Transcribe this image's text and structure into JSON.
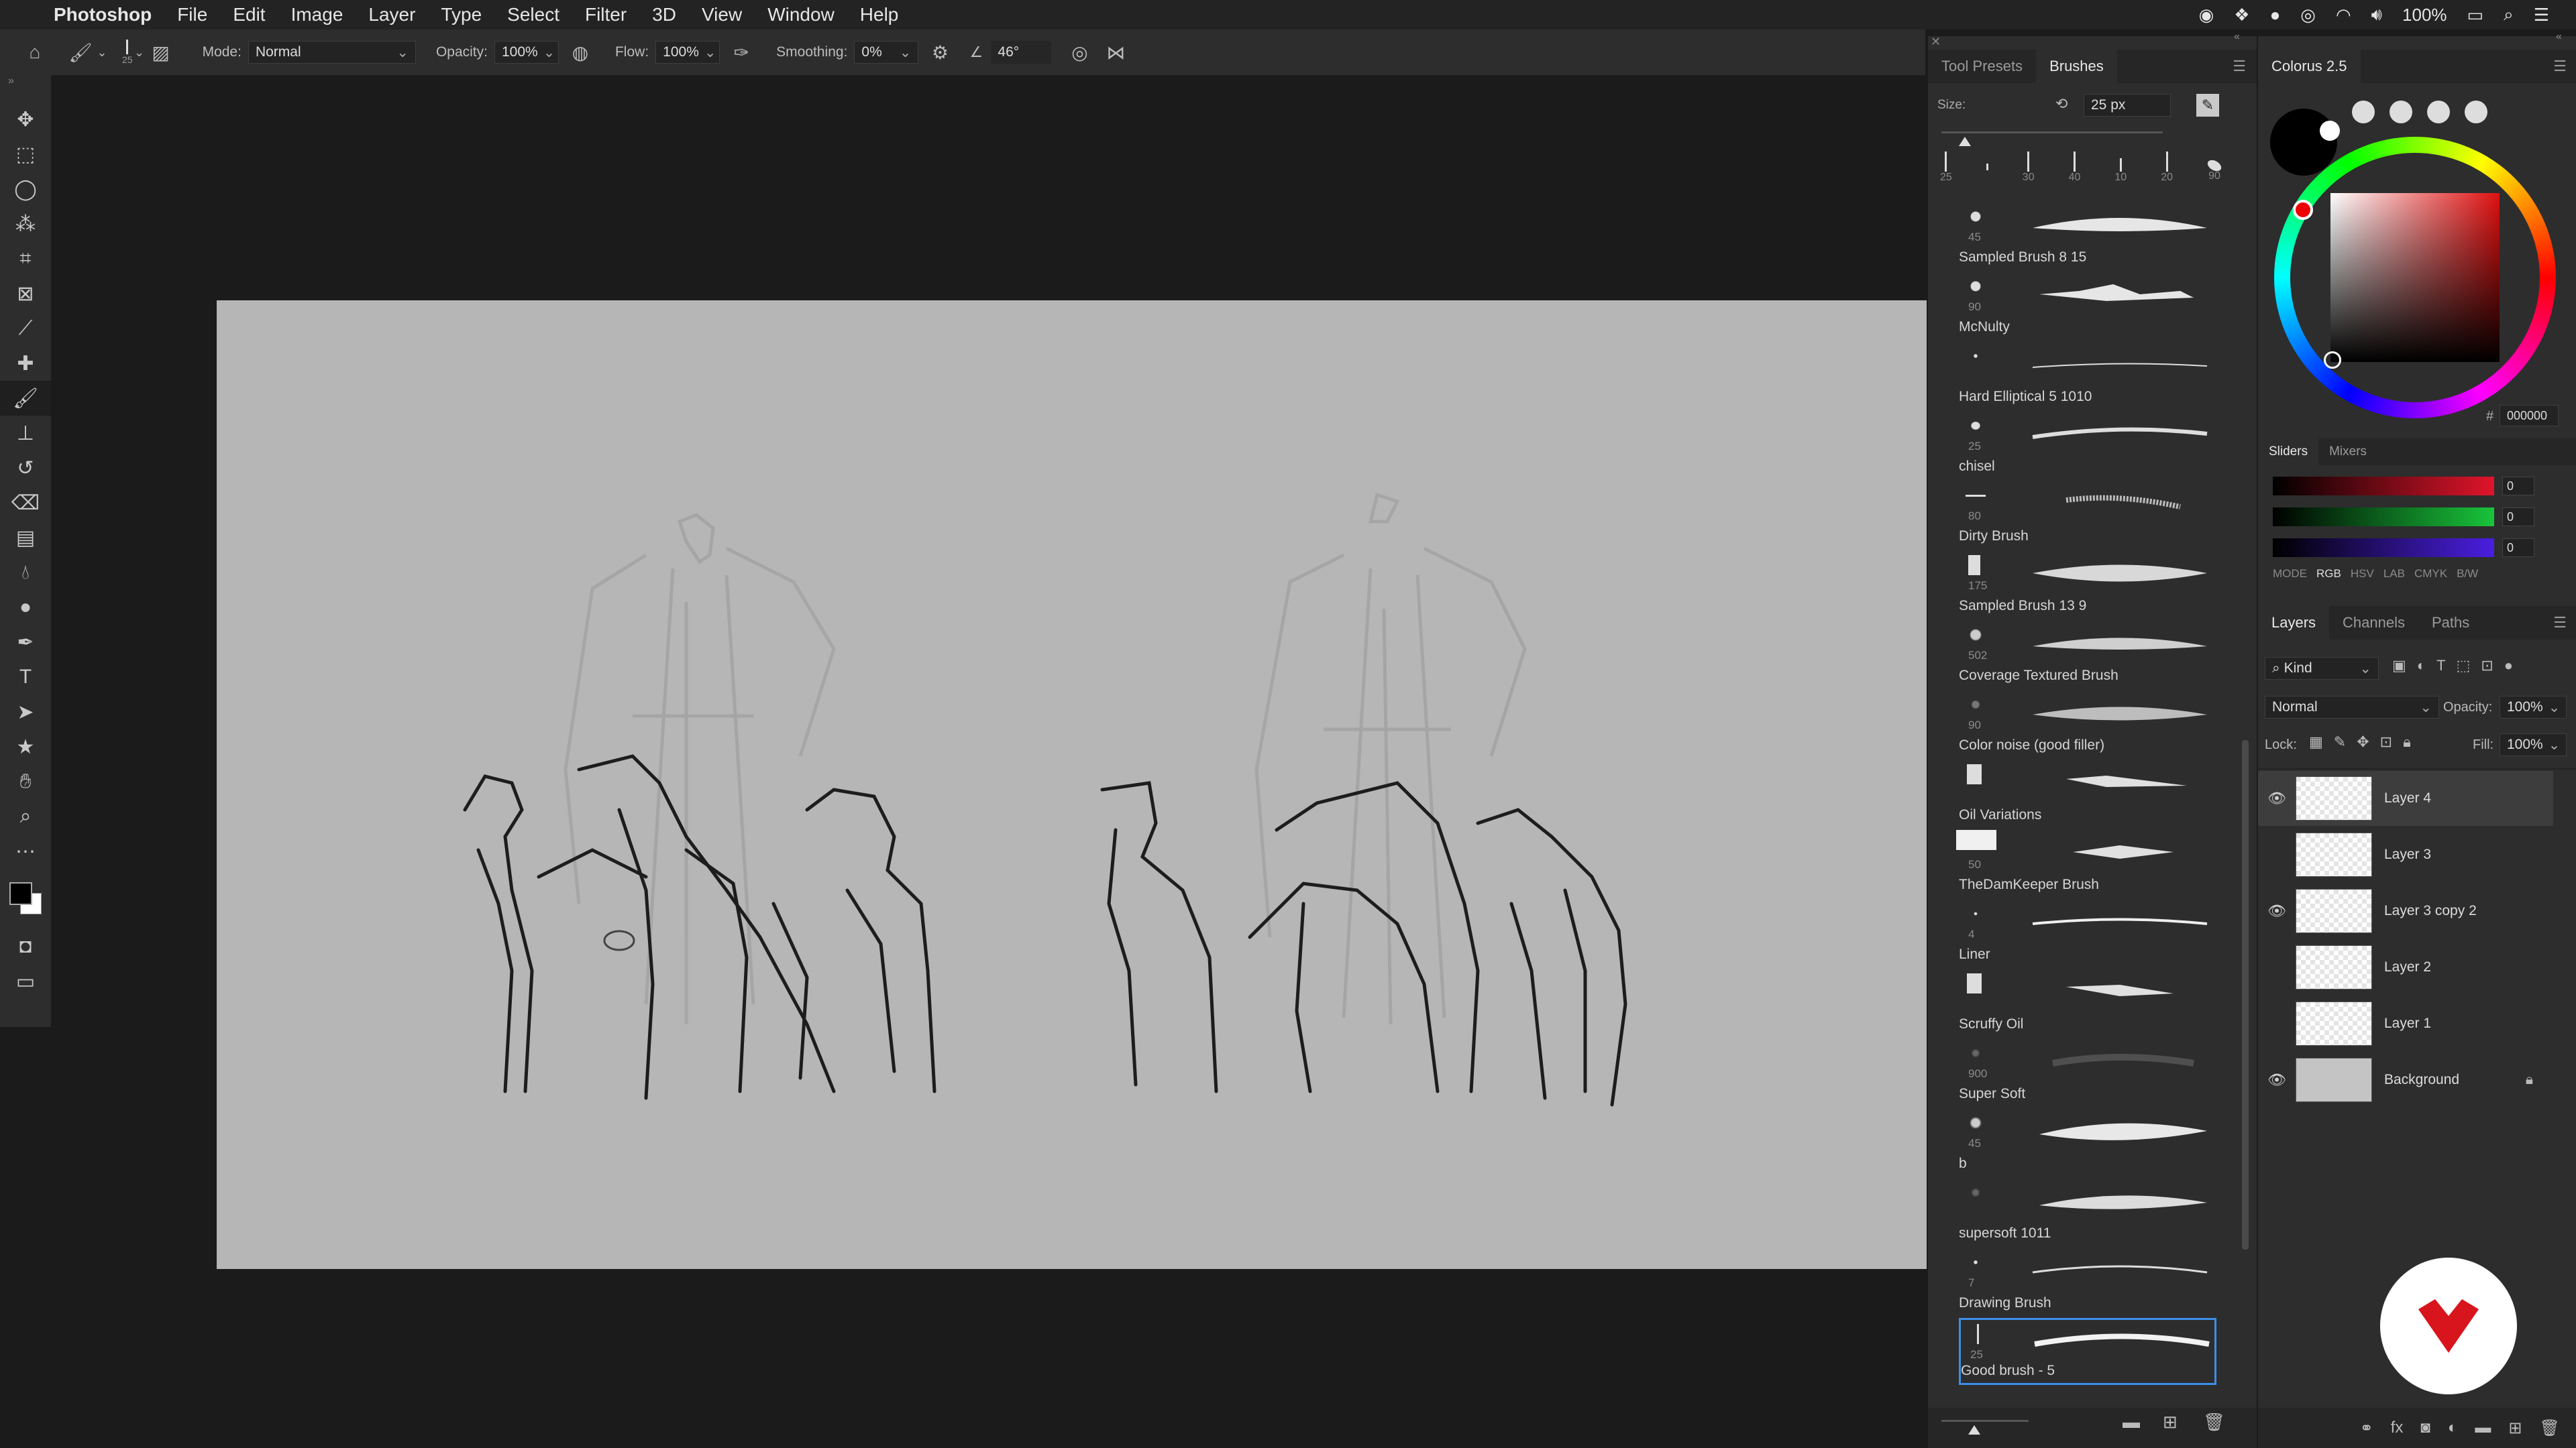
{
  "menubar": {
    "app_name": "Photoshop",
    "items": [
      "File",
      "Edit",
      "Image",
      "Layer",
      "Type",
      "Select",
      "Filter",
      "3D",
      "View",
      "Window",
      "Help"
    ],
    "battery": "100%"
  },
  "options": {
    "brush_size": "25",
    "mode_label": "Mode:",
    "mode_value": "Normal",
    "opacity_label": "Opacity:",
    "opacity_value": "100%",
    "flow_label": "Flow:",
    "flow_value": "100%",
    "smoothing_label": "Smoothing:",
    "smoothing_value": "0%",
    "angle_value": "46°"
  },
  "brushes_panel": {
    "tabs": [
      "Tool Presets",
      "Brushes"
    ],
    "size_label": "Size:",
    "size_value": "25 px",
    "preset_sizes": [
      "25",
      "",
      "30",
      "40",
      "10",
      "20",
      "90"
    ],
    "brushes": [
      {
        "name": "Sampled Brush 8 15",
        "size": "45"
      },
      {
        "name": "McNulty",
        "size": "90"
      },
      {
        "name": "Hard Elliptical 5 1010",
        "size": ""
      },
      {
        "name": "chisel",
        "size": "25"
      },
      {
        "name": "Dirty Brush",
        "size": "80"
      },
      {
        "name": "Sampled Brush 13 9",
        "size": "175"
      },
      {
        "name": "Coverage Textured Brush",
        "size": "502"
      },
      {
        "name": "Color noise (good filler)",
        "size": "90"
      },
      {
        "name": "Oil Variations",
        "size": ""
      },
      {
        "name": "TheDamKeeper Brush",
        "size": "50"
      },
      {
        "name": "Liner",
        "size": "4"
      },
      {
        "name": "Scruffy Oil",
        "size": ""
      },
      {
        "name": "Super Soft",
        "size": "900"
      },
      {
        "name": "b",
        "size": "45"
      },
      {
        "name": "supersoft 1011",
        "size": ""
      },
      {
        "name": "Drawing Brush",
        "size": "7"
      },
      {
        "name": "Good brush - 5",
        "size": "25"
      }
    ]
  },
  "color_panel": {
    "title": "Colorus 2.5",
    "hex_value": "000000",
    "tabs": [
      "Sliders",
      "Mixers"
    ],
    "slider_values": [
      "0",
      "0",
      "0"
    ],
    "mode_label": "MODE",
    "modes": [
      "RGB",
      "HSV",
      "LAB",
      "CMYK",
      "B/W"
    ],
    "colors": {
      "red": "#e0142a",
      "green": "#18c43a",
      "blue": "#4a1ee0"
    }
  },
  "layers_panel": {
    "tabs": [
      "Layers",
      "Channels",
      "Paths"
    ],
    "kind_label": "Kind",
    "blend_mode": "Normal",
    "opacity_label": "Opacity:",
    "opacity_value": "100%",
    "lock_label": "Lock:",
    "fill_label": "Fill:",
    "fill_value": "100%",
    "layers": [
      {
        "name": "Layer 4",
        "visible": true,
        "active": true
      },
      {
        "name": "Layer 3",
        "visible": false,
        "active": false
      },
      {
        "name": "Layer 3 copy 2",
        "visible": true,
        "active": false
      },
      {
        "name": "Layer 2",
        "visible": false,
        "active": false
      },
      {
        "name": "Layer 1",
        "visible": false,
        "active": false
      },
      {
        "name": "Background",
        "visible": true,
        "active": false
      }
    ]
  }
}
